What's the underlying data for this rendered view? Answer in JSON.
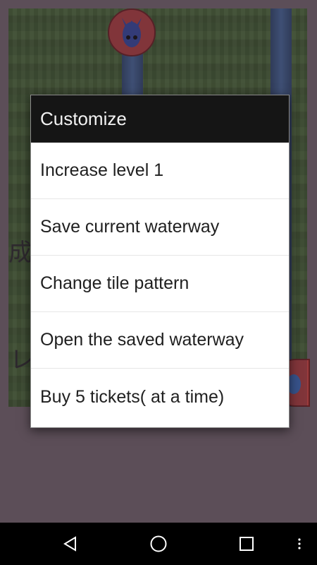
{
  "background": {
    "glyph_a": "成",
    "glyph_b": "レ"
  },
  "dialog": {
    "title": "Customize",
    "items": [
      {
        "label": "Increase level 1"
      },
      {
        "label": "Save current waterway"
      },
      {
        "label": "Change tile pattern"
      },
      {
        "label": "Open the saved waterway"
      },
      {
        "label": "Buy 5 tickets( at a time)"
      }
    ]
  },
  "navbar": {
    "back_icon": "back-triangle-icon",
    "home_icon": "home-circle-icon",
    "recent_icon": "recent-apps-square-icon",
    "more_icon": "more-vertical-icon"
  },
  "colors": {
    "header_bg": "#151515",
    "dialog_bg": "#ffffff",
    "page_bg": "#655761"
  }
}
